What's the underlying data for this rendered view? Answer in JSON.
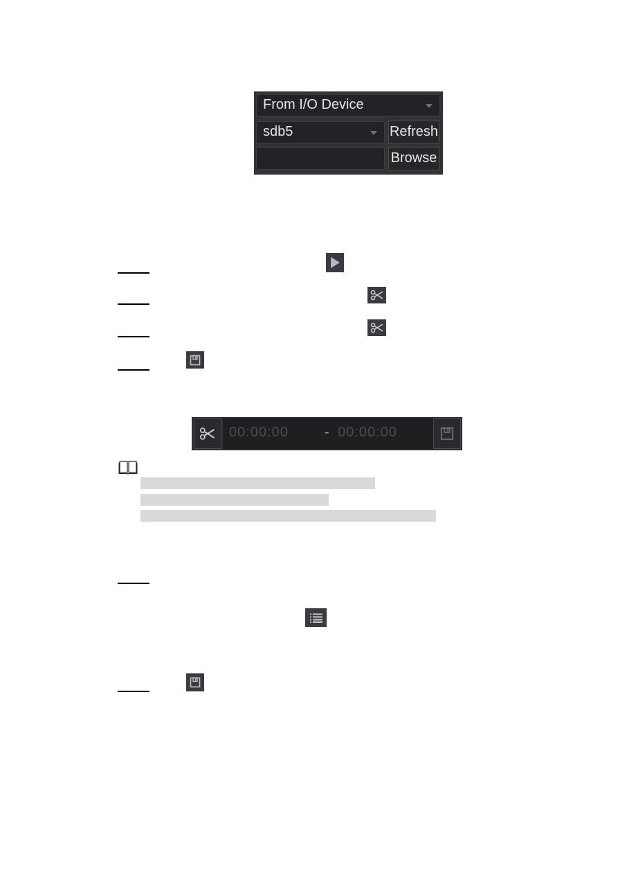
{
  "import_panel": {
    "source_select": "From I/O Device",
    "device_select": "sdb5",
    "path_input_value": "",
    "refresh_label": "Refresh",
    "browse_label": "Browse"
  },
  "steps": {
    "icons": [
      "play-icon",
      "scissors-icon",
      "scissors-icon",
      "save-icon"
    ]
  },
  "clip_bar": {
    "start_time": "00:00:00",
    "separator": "-",
    "end_time": "00:00:00"
  },
  "note": {
    "icon": "book-icon",
    "lines": 3
  },
  "second_procedure": {
    "icons": [
      "list-icon",
      "save-icon"
    ]
  },
  "colors": {
    "panel_bg": "#333336",
    "field_bg": "#232327",
    "icon_bg": "#3a3b40",
    "note_highlight": "#d9d9d9"
  }
}
